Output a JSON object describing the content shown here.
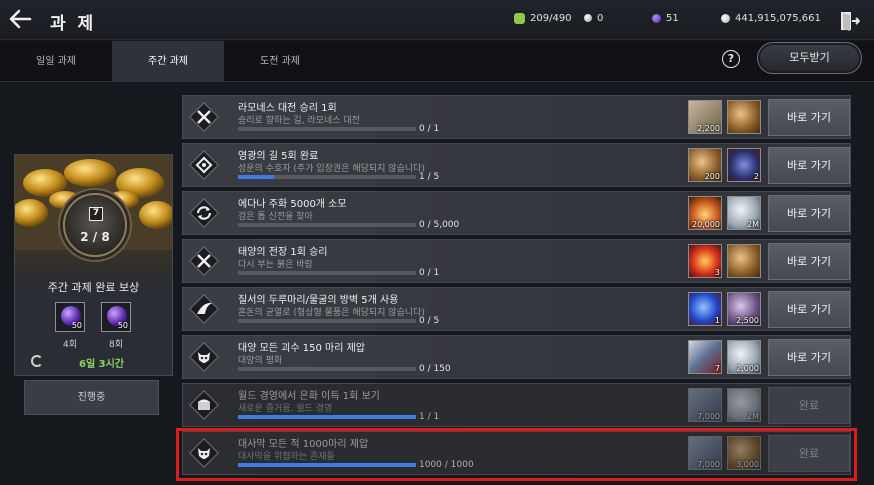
{
  "header": {
    "title": "과 제",
    "back_icon": "back-arrow-icon",
    "exit_icon": "exit-door-icon",
    "currencies": [
      {
        "icon": "energy-icon",
        "value": "209/490",
        "color": "#8fc84a"
      },
      {
        "icon": "pearl-icon",
        "value": "0",
        "color": "#d8d8d8"
      },
      {
        "icon": "gem-icon",
        "value": "51",
        "color": "#7a4fd8"
      },
      {
        "icon": "silver-coin-icon",
        "value": "441,915,075,661",
        "color": "#e8e8e8"
      }
    ]
  },
  "tabs": [
    {
      "label": "일일 과제",
      "active": false
    },
    {
      "label": "주간 과제",
      "active": true
    },
    {
      "label": "도전 과제",
      "active": false
    }
  ],
  "claim_all_label": "모두받기",
  "help_label": "?",
  "reward_card": {
    "count": "2 / 8",
    "book_label": "7",
    "title": "주간 과제 완료 보상",
    "items": [
      {
        "qty": "50",
        "label": "4회",
        "icon": "purple-orb-icon"
      },
      {
        "qty": "50",
        "label": "8회",
        "icon": "purple-orb-icon"
      }
    ],
    "timer": "6일 3시간",
    "status_button": "진행중"
  },
  "quests": [
    {
      "icon": "crossed-swords-icon",
      "title": "라모네스 대전 승리 1회",
      "subtitle": "승리로 향하는 길, 라모네스 대전",
      "progress": "0 / 1",
      "ratio": 0,
      "rewards": [
        {
          "icon": "stone-chest-icon",
          "qty": "2,200"
        },
        {
          "icon": "bronze-coin-icon",
          "qty": ""
        }
      ],
      "button": "바로 가기",
      "done": false
    },
    {
      "icon": "diamond-emblem-icon",
      "title": "영광의 길 5회 완료",
      "subtitle": "성운의 수호자 (주가 입장권은 해당되지 않습니다)",
      "progress": "1 / 5",
      "ratio": 0.2,
      "rewards": [
        {
          "icon": "bronze-coin-icon",
          "qty": "200"
        },
        {
          "icon": "cube-icon",
          "qty": "2"
        }
      ],
      "button": "바로 가기",
      "done": false
    },
    {
      "icon": "cycle-icon",
      "title": "에다나 주화 5000개 소모",
      "subtitle": "검은 톱 신전을 찾아",
      "progress": "0 / 5,000",
      "ratio": 0,
      "rewards": [
        {
          "icon": "flame-chest-icon",
          "qty": "20,000"
        },
        {
          "icon": "silver-coin-icon",
          "qty": "2M"
        }
      ],
      "button": "바로 가기",
      "done": false
    },
    {
      "icon": "crossed-swords-icon",
      "title": "태양의 전장 1회 승리",
      "subtitle": "다시 부는 붉은 바람",
      "progress": "0 / 1",
      "ratio": 0,
      "rewards": [
        {
          "icon": "fire-gem-icon",
          "qty": "3"
        },
        {
          "icon": "bronze-coin-icon",
          "qty": ""
        }
      ],
      "button": "바로 가기",
      "done": false
    },
    {
      "icon": "bird-emblem-icon",
      "title": "질서의 두루마리/물굴의 방벽 5개 사용",
      "subtitle": "혼돈의 균열로 (형상형 물품은 해당되지 않습니다)",
      "progress": "0 / 5",
      "ratio": 0,
      "rewards": [
        {
          "icon": "blue-crystal-icon",
          "qty": "1"
        },
        {
          "icon": "purple-coin-icon",
          "qty": "2,500"
        }
      ],
      "button": "바로 가기",
      "done": false
    },
    {
      "icon": "demon-skull-icon",
      "title": "대양 모든 괴수 150 마리 제압",
      "subtitle": "대양의 평화",
      "progress": "0 / 150",
      "ratio": 0,
      "rewards": [
        {
          "icon": "scroll-box-icon",
          "qty": "7"
        },
        {
          "icon": "silver-coin-icon",
          "qty": "2,000"
        }
      ],
      "button": "바로 가기",
      "done": false
    },
    {
      "icon": "treasure-emblem-icon",
      "title": "월드 경영에서 은화 이득 1회 보기",
      "subtitle": "새로운 즐거움, 월드 경영",
      "progress": "1 / 1",
      "ratio": 1,
      "rewards": [
        {
          "icon": "pillar-icon",
          "qty": "7,000"
        },
        {
          "icon": "silver-coin-icon",
          "qty": "2M"
        }
      ],
      "button": "완료",
      "done": true
    },
    {
      "icon": "demon-skull-icon",
      "title": "대사막 모든 적 1000마리 제압",
      "subtitle": "대사막을 위협하는 존재들",
      "progress": "1000 / 1000",
      "ratio": 1,
      "rewards": [
        {
          "icon": "pillar-icon",
          "qty": "7,000"
        },
        {
          "icon": "bronze-coin-icon",
          "qty": "3,000"
        }
      ],
      "button": "완료",
      "done": true
    }
  ]
}
